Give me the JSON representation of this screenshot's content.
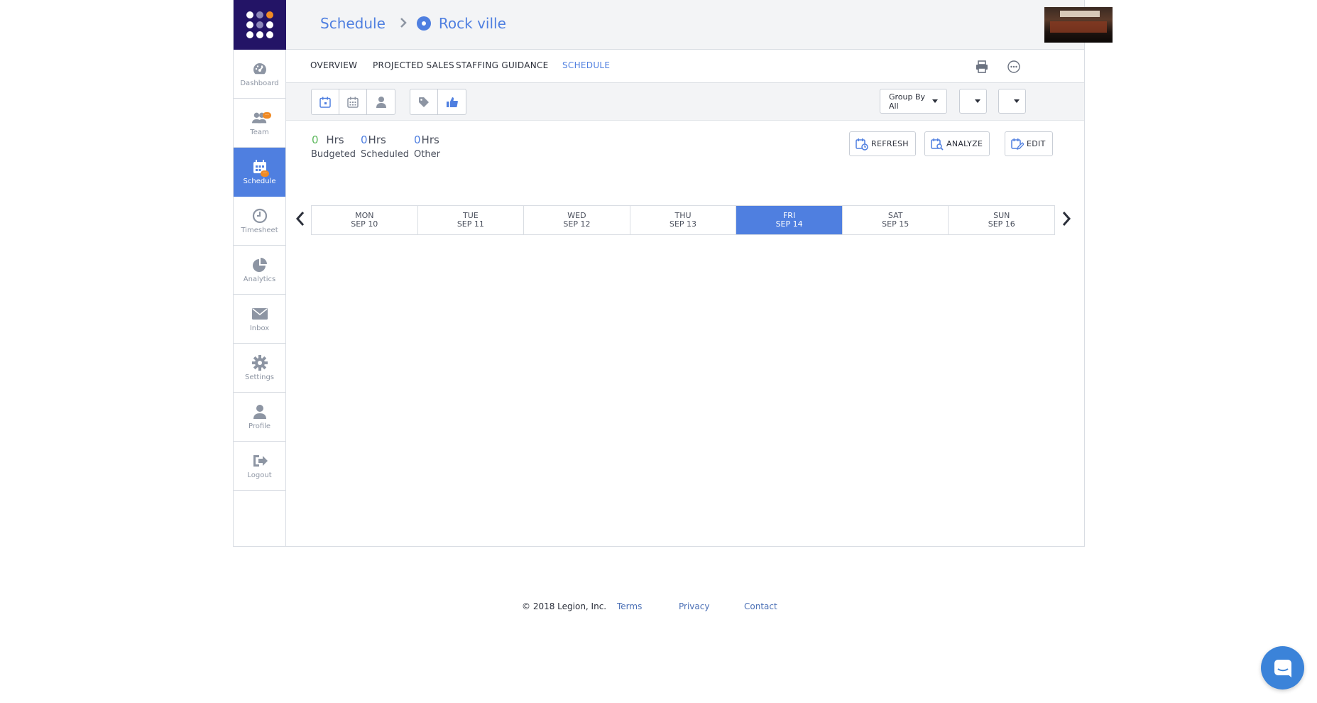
{
  "sidebar": {
    "items": [
      {
        "label": "Dashboard"
      },
      {
        "label": "Team"
      },
      {
        "label": "Schedule"
      },
      {
        "label": "Timesheet"
      },
      {
        "label": "Analytics"
      },
      {
        "label": "Inbox"
      },
      {
        "label": "Settings"
      },
      {
        "label": "Profile"
      },
      {
        "label": "Logout"
      }
    ],
    "active": "Schedule",
    "badge_text": "···"
  },
  "header": {
    "breadcrumb_root": "Schedule",
    "breadcrumb_separator": ">",
    "location": "Rock ville"
  },
  "tabs": [
    {
      "label": "OVERVIEW"
    },
    {
      "label": "PROJECTED SALES"
    },
    {
      "label": "STAFFING GUIDANCE"
    },
    {
      "label": "SCHEDULE"
    }
  ],
  "active_tab": "SCHEDULE",
  "toolbar": {
    "group_by": "Group By All",
    "select_2": "",
    "select_3": ""
  },
  "summary": {
    "budgeted_value": "0",
    "budgeted_unit": "Hrs",
    "budgeted_label": "Budgeted",
    "scheduled_value": "0",
    "scheduled_unit": "Hrs",
    "scheduled_label": "Scheduled",
    "other_value": "0",
    "other_unit": "Hrs",
    "other_label": "Other"
  },
  "actions": {
    "refresh": "REFRESH",
    "analyze": "ANALYZE",
    "edit": "EDIT"
  },
  "week": [
    {
      "dow": "MON",
      "date": "SEP 10"
    },
    {
      "dow": "TUE",
      "date": "SEP 11"
    },
    {
      "dow": "WED",
      "date": "SEP 12"
    },
    {
      "dow": "THU",
      "date": "SEP 13"
    },
    {
      "dow": "FRI",
      "date": "SEP 14"
    },
    {
      "dow": "SAT",
      "date": "SEP 15"
    },
    {
      "dow": "SUN",
      "date": "SEP 16"
    }
  ],
  "selected_day": "FRI",
  "footer": {
    "copyright": "© 2018 Legion, Inc.",
    "terms": "Terms",
    "privacy": "Privacy",
    "contact": "Contact"
  },
  "colors": {
    "brand_navy": "#231466",
    "accent_blue": "#4f7fe0",
    "badge_orange": "#f08a24",
    "budget_green": "#5cb85c"
  },
  "icons": {
    "sidebar": [
      "dashboard-gauge-icon",
      "team-icon",
      "calendar-icon",
      "clock-icon",
      "pie-chart-icon",
      "envelope-icon",
      "gear-icon",
      "person-icon",
      "logout-icon"
    ],
    "toolbar": [
      "day-view-icon",
      "week-view-icon",
      "employee-view-icon",
      "tag-icon",
      "thumbs-up-icon"
    ],
    "header": [
      "location-pin-icon",
      "print-icon",
      "more-options-icon"
    ],
    "chat": "chat-bubble-icon"
  }
}
